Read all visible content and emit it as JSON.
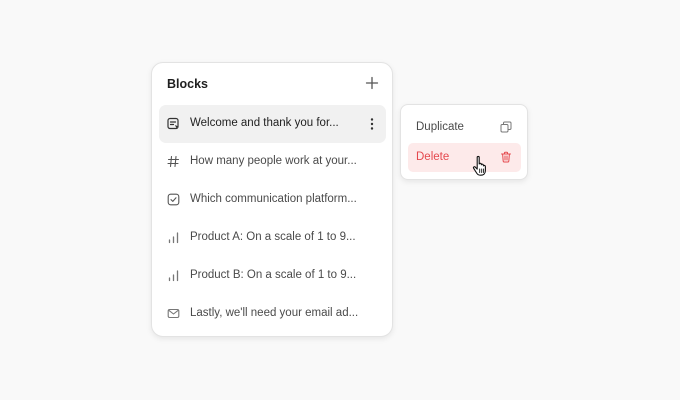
{
  "panel": {
    "title": "Blocks",
    "add_icon": "plus-icon",
    "items": [
      {
        "label": "Welcome and thank you for...",
        "icon": "welcome-screen-icon",
        "active": true
      },
      {
        "label": "How many people work at your...",
        "icon": "hash-icon"
      },
      {
        "label": "Which communication platform...",
        "icon": "checkbox-icon"
      },
      {
        "label": "Product A: On a scale of 1 to 9...",
        "icon": "bar-chart-icon"
      },
      {
        "label": "Product B: On a scale of 1 to 9...",
        "icon": "bar-chart-icon"
      },
      {
        "label": "Lastly, we'll need your email ad...",
        "icon": "mail-icon"
      }
    ],
    "more_icon": "more-vertical-icon"
  },
  "context_menu": {
    "items": [
      {
        "label": "Duplicate",
        "icon": "copy-icon"
      },
      {
        "label": "Delete",
        "icon": "trash-icon",
        "color": "#e5484d",
        "highlight": "#fdeaea"
      }
    ]
  },
  "colors": {
    "background": "#f9f9f9",
    "panel": "#ffffff",
    "active_row": "#f1f1f1",
    "danger": "#e5484d"
  }
}
